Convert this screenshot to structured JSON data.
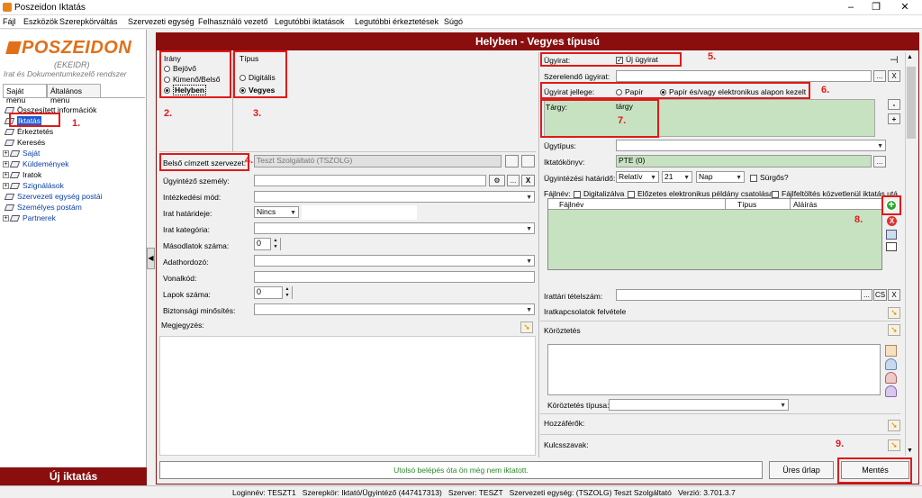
{
  "window": {
    "title": "Poszeidon Iktatás",
    "min": "–",
    "max": "❐",
    "close": "✕"
  },
  "menu": [
    "Fájl",
    "Eszközök",
    "Szerepkörváltás",
    "Szervezeti egység",
    "Felhasználó vezető",
    "Legutóbbi iktatások",
    "Legutóbbi érkeztetések",
    "Súgó"
  ],
  "logo": {
    "name": "POSZEIDON",
    "sub": "(EKEIDR)",
    "tagline": "Irat és Dokumentumkezelő rendszer"
  },
  "left_tabs": [
    "Saját menü",
    "Általános menü"
  ],
  "tree": [
    {
      "label": "Összesített információk",
      "pm": "",
      "blue": false
    },
    {
      "label": "Iktatás",
      "pm": "",
      "blue": false,
      "selected": true
    },
    {
      "label": "Érkeztetés",
      "pm": "",
      "blue": false
    },
    {
      "label": "Keresés",
      "pm": "",
      "blue": false
    },
    {
      "label": "Saját",
      "pm": "+",
      "blue": true
    },
    {
      "label": "Küldemények",
      "pm": "+",
      "blue": true
    },
    {
      "label": "Iratok",
      "pm": "+",
      "blue": false
    },
    {
      "label": "Szignálások",
      "pm": "+",
      "blue": true
    },
    {
      "label": "Szervezeti egység postái",
      "pm": "",
      "blue": true
    },
    {
      "label": "Személyes postám",
      "pm": "",
      "blue": true
    },
    {
      "label": "Partnerek",
      "pm": "+",
      "blue": true
    }
  ],
  "new_button": "Új iktatás",
  "form_title": "Helyben - Vegyes típusú",
  "irany": {
    "title": "Irány",
    "options": [
      "Bejövő",
      "Kimenő/Belső",
      "Helyben"
    ],
    "selected": 2
  },
  "tipus": {
    "title": "Típus",
    "options": [
      "Digitális",
      "Vegyes"
    ],
    "selected": 1
  },
  "left_fields": {
    "belso_cimzett": {
      "label": "Belső címzett szervezet:",
      "value": "Teszt Szolgáltató (TSZOLG)"
    },
    "ugyintezo": "Ügyintéző személy:",
    "intezkedesi": "Intézkedési mód:",
    "irat_hatarido": {
      "label": "Irat határideje:",
      "value": "Nincs"
    },
    "irat_kategoria": "Irat kategória:",
    "masolatok": {
      "label": "Másodlatok száma:",
      "value": "0"
    },
    "adathordozo": "Adathordozó:",
    "vonalkod": "Vonalkód:",
    "lapok": {
      "label": "Lapok száma:",
      "value": "0"
    },
    "biztonsagi": "Biztonsági minősítés:",
    "megjegyzes": "Megjegyzés:"
  },
  "right_fields": {
    "ugyirat": {
      "label": "Ügyirat:",
      "checkbox_label": "Új ügyirat"
    },
    "szerelendo": "Szerelendő ügyirat:",
    "jellege": {
      "label": "Ügyirat jellege:",
      "options": [
        "Papír",
        "Papír és/vagy elektronikus alapon kezelt"
      ],
      "selected": 1
    },
    "targy": {
      "label": "Tárgy:",
      "value": "tárgy"
    },
    "ugytipus": "Ügytípus:",
    "iktatokonyv": {
      "label": "Iktatókönyv:",
      "value": "PTE (0)"
    },
    "hatarido": {
      "label": "Ügyintézési határidő:",
      "mode": "Relatív",
      "number": "21",
      "unit": "Nap",
      "surgos": "Sürgős?"
    },
    "fajlnev_row": {
      "label": "Fájlnév:",
      "digitalizalva": "Digitalizálva",
      "elozetes": "Előzetes elektronikus példány csatolása",
      "fajlfeltoltes": "Fájlfeltöltés közvetlenül iktatás után"
    },
    "table_cols": [
      "Fájlnév",
      "Típus",
      "Aláírás"
    ],
    "irattari": {
      "label": "Irattári tételszám:",
      "cs": "CS"
    },
    "iratkapcsolatok": "Iratkapcsolatok felvétele",
    "koroztetes": "Köröztetés",
    "koroztetes_tipusa": "Köröztetés típusa:",
    "hozzaferok": "Hozzáférők:",
    "kulcsszavak": "Kulcsszavak:"
  },
  "buttons": {
    "ellipsis": "...",
    "x": "X",
    "up": "▲",
    "down": "▼",
    "minus": "-",
    "plus": "+",
    "arrow": "➘",
    "pin": "⊣"
  },
  "bottom": {
    "message": "Utolsó belépés óta ön még nem iktatott.",
    "clear": "Üres űrlap",
    "save": "Mentés"
  },
  "statusbar": "Loginnév: TESZT1   Szerepkör: Iktató/Ügyintéző (447417313)   Szerver: TESZT   Szervezeti egység: (TSZOLG) Teszt Szolgáltató   Verzió: 3.701.3.7",
  "annotations": [
    "1.",
    "2.",
    "3.",
    "4.",
    "5.",
    "6.",
    "7.",
    "8.",
    "9."
  ],
  "colors": {
    "accent": "#8a0e0e",
    "logo": "#e0701a",
    "annotation": "#e01a1a",
    "green_field": "#c7e2c1"
  }
}
